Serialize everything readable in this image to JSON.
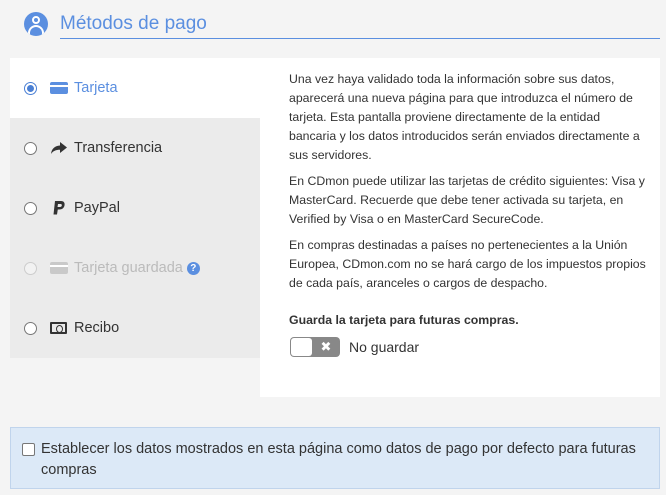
{
  "header": {
    "title": "Métodos de pago",
    "icon": "user-circle-icon"
  },
  "methods": [
    {
      "label": "Tarjeta",
      "icon": "credit-card-icon",
      "selected": true,
      "disabled": false
    },
    {
      "label": "Transferencia",
      "icon": "share-arrow-icon",
      "selected": false,
      "disabled": false
    },
    {
      "label": "PayPal",
      "icon": "paypal-icon",
      "selected": false,
      "disabled": false
    },
    {
      "label": "Tarjeta guardada",
      "icon": "credit-card-icon",
      "selected": false,
      "disabled": true
    },
    {
      "label": "Recibo",
      "icon": "bill-icon",
      "selected": false,
      "disabled": false
    }
  ],
  "panel": {
    "paragraphs": [
      "Una vez haya validado toda la información sobre sus datos, aparecerá una nueva página para que introduzca el número de tarjeta. Esta pantalla proviene directamente de la entidad bancaria y los datos introducidos serán enviados directamente a sus servidores.",
      "En CDmon puede utilizar las tarjetas de crédito siguientes: Visa y MasterCard. Recuerde que debe tener activada su tarjeta, en Verified by Visa o en MasterCard SecureCode.",
      "En compras destinadas a países no pertenecientes a la Unión Europea, CDmon.com no se hará cargo de los impuestos propios de cada país, aranceles o cargos de despacho."
    ],
    "save_title": "Guarda la tarjeta para futuras compras.",
    "toggle_label": "No guardar",
    "toggle_on": false
  },
  "default_option": {
    "label": "Establecer los datos mostrados en esta página como datos de pago por defecto para futuras compras",
    "checked": false
  },
  "colors": {
    "accent": "#5b8fe0",
    "tab_bg": "#ebebeb",
    "page_bg": "#f4f4f4",
    "info_bg": "#dce9f7"
  }
}
